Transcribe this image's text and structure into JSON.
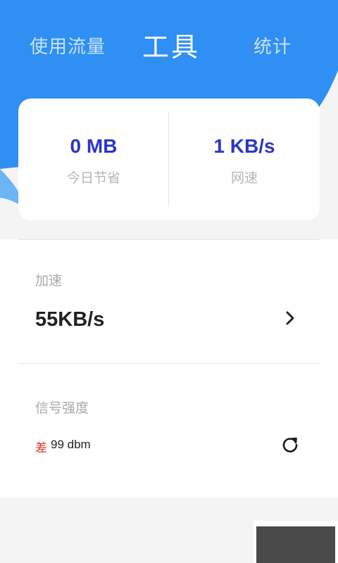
{
  "header": {
    "tabs": [
      {
        "label": "使用流量"
      },
      {
        "label": "工具"
      },
      {
        "label": "统计"
      }
    ],
    "active_tab": "工具",
    "accent_color": "#2f8ff2"
  },
  "stats": {
    "saved_today": {
      "value": "0 MB",
      "label": "今日节省"
    },
    "network_speed": {
      "value": "1 KB/s",
      "label": "网速"
    },
    "value_color": "#2c35c7"
  },
  "acceleration": {
    "label": "加速",
    "value": "55KB/s",
    "icon": "chevron-right-icon"
  },
  "signal": {
    "label": "信号强度",
    "quality": "差",
    "quality_color": "#e0322a",
    "dbm": "99 dbm",
    "icon": "refresh-icon"
  }
}
